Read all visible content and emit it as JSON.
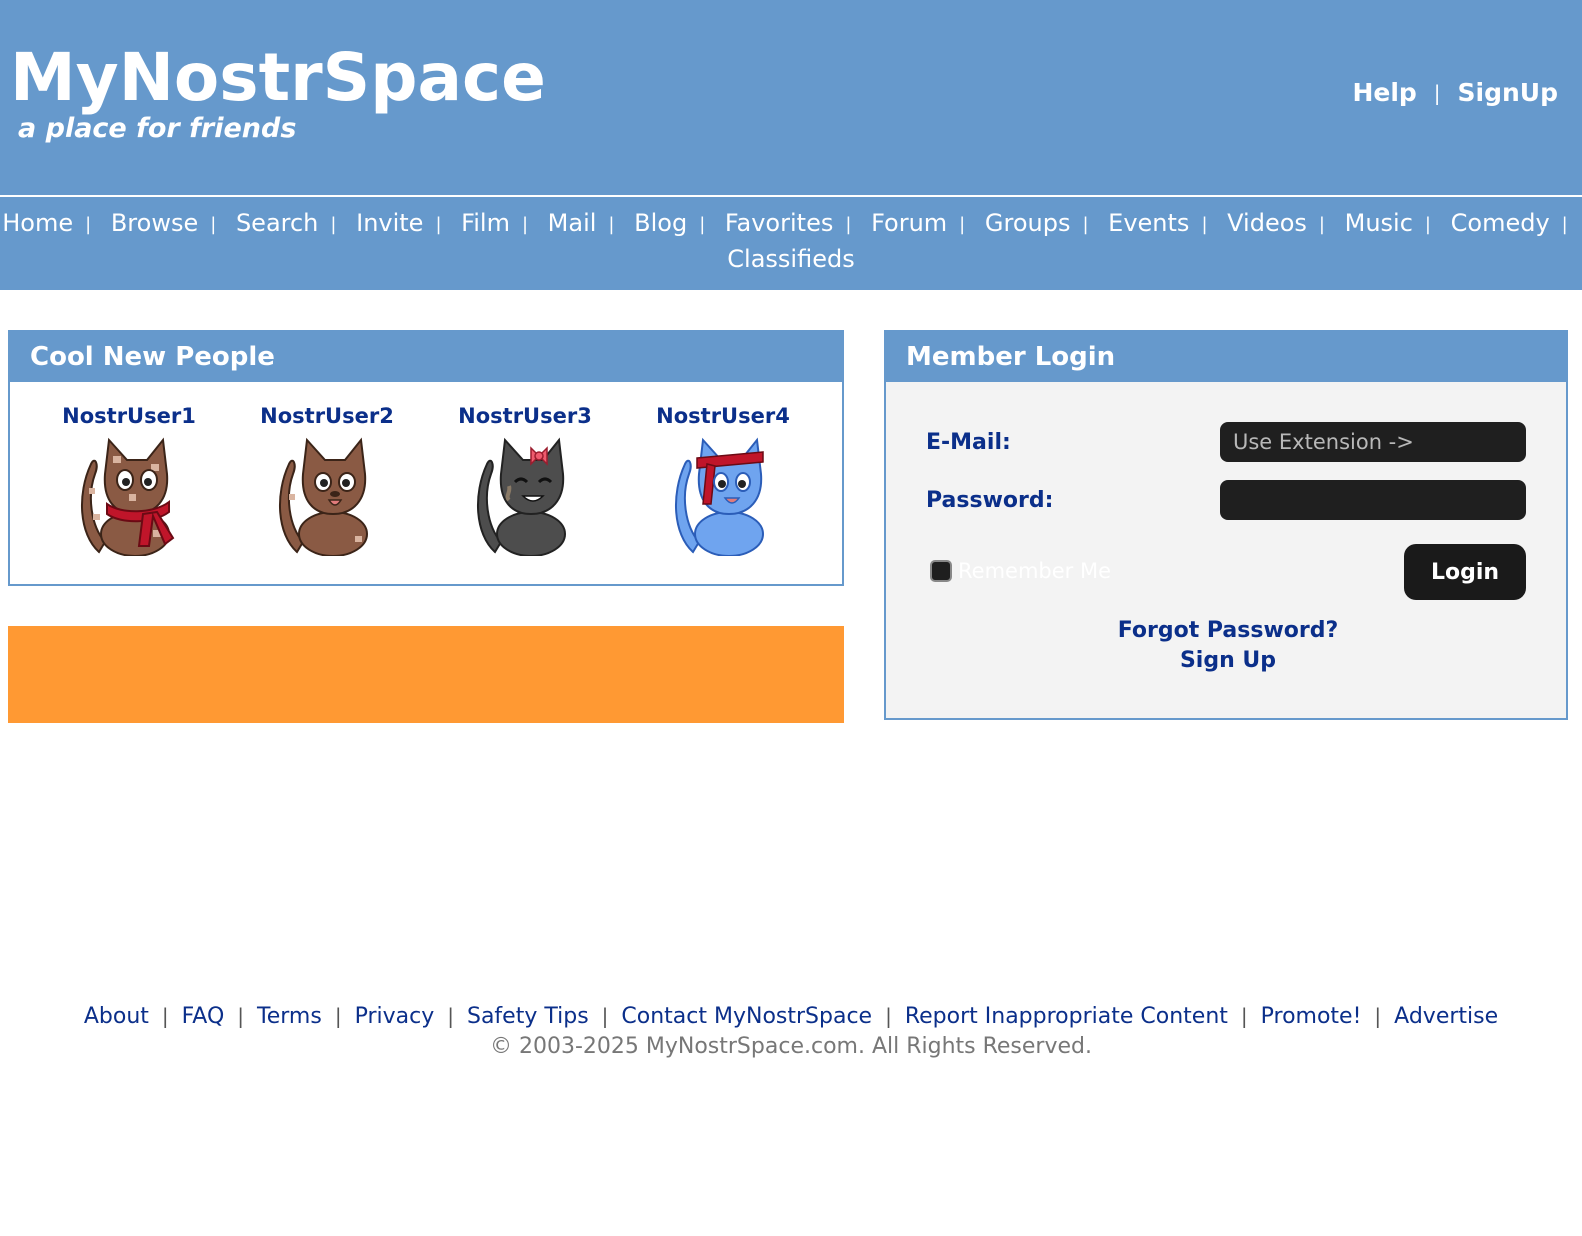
{
  "header": {
    "logo": "MyNostrSpace",
    "tagline": "a place for friends",
    "links": [
      "Help",
      "SignUp"
    ],
    "background": "#6699cc"
  },
  "nav": {
    "items": [
      "Home",
      "Browse",
      "Search",
      "Invite",
      "Film",
      "Mail",
      "Blog",
      "Favorites",
      "Forum",
      "Groups",
      "Events",
      "Videos",
      "Music",
      "Comedy",
      "Classifieds"
    ]
  },
  "people": {
    "title": "Cool New People",
    "users": [
      {
        "name": "NostrUser1",
        "avatar": "brown-spotted-cat-red-scarf"
      },
      {
        "name": "NostrUser2",
        "avatar": "brown-cat"
      },
      {
        "name": "NostrUser3",
        "avatar": "gray-cat-pink-bow"
      },
      {
        "name": "NostrUser4",
        "avatar": "blue-cat-red-headband"
      }
    ]
  },
  "banner": {
    "color": "#ff9933"
  },
  "login": {
    "title": "Member Login",
    "email_label": "E-Mail:",
    "email_placeholder": "Use Extension ->",
    "password_label": "Password:",
    "password_value": "",
    "remember_label": "Remember Me",
    "remember_checked": false,
    "login_button": "Login",
    "forgot_link": "Forgot Password?",
    "signup_link": "Sign Up"
  },
  "footer": {
    "links": [
      "About",
      "FAQ",
      "Terms",
      "Privacy",
      "Safety Tips",
      "Contact MyNostrSpace",
      "Report Inappropriate Content",
      "Promote!",
      "Advertise"
    ],
    "copyright": "© 2003-2025 MyNostrSpace.com. All Rights Reserved."
  }
}
